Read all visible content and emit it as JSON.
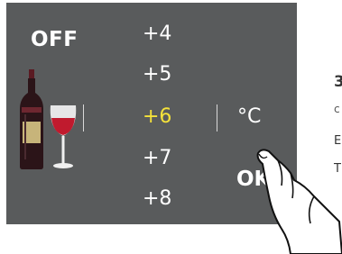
{
  "panel": {
    "off_label": "OFF",
    "ok_label": "OK",
    "unit": "°C",
    "temperatures": [
      "+4",
      "+5",
      "+6",
      "+7",
      "+8"
    ],
    "selected_index": 2,
    "colors": {
      "background": "#595b5c",
      "text": "#ffffff",
      "selected": "#f5e23a"
    }
  },
  "icons": {
    "wine": "wine-bottle-and-glass-icon",
    "hand": "pointing-hand-icon"
  },
  "side_text": {
    "heading": "3",
    "line1": "c",
    "line2": "E",
    "line3": "T"
  }
}
